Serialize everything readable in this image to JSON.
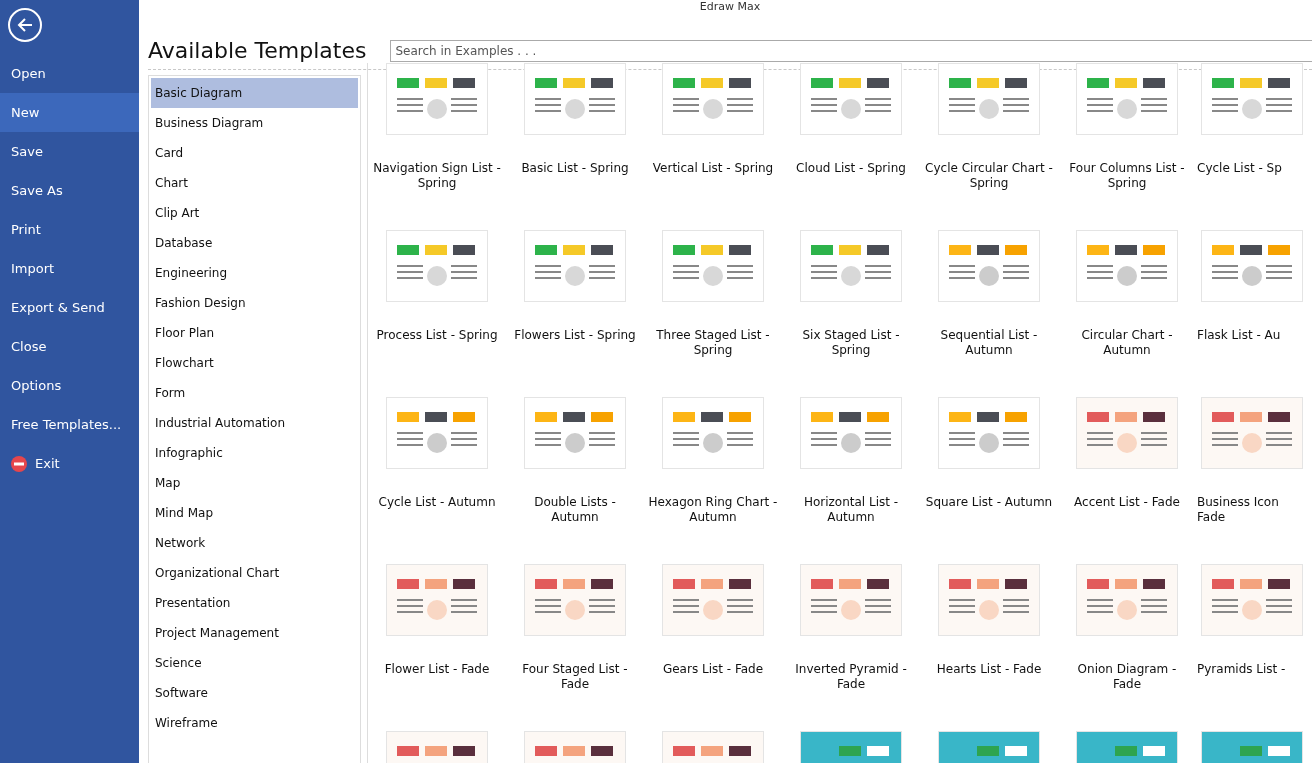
{
  "window": {
    "title": "Edraw Max"
  },
  "nav": [
    {
      "label": "Open",
      "selected": false
    },
    {
      "label": "New",
      "selected": true
    },
    {
      "label": "Save",
      "selected": false
    },
    {
      "label": "Save As",
      "selected": false
    },
    {
      "label": "Print",
      "selected": false
    },
    {
      "label": "Import",
      "selected": false
    },
    {
      "label": "Export & Send",
      "selected": false
    },
    {
      "label": "Close",
      "selected": false
    },
    {
      "label": "Options",
      "selected": false
    },
    {
      "label": "Free Templates...",
      "selected": false
    },
    {
      "label": "Exit",
      "selected": false,
      "kind": "exit"
    }
  ],
  "heading": "Available Templates",
  "search": {
    "placeholder": "Search in Examples . . ."
  },
  "categories": [
    {
      "label": "Basic Diagram",
      "selected": true
    },
    {
      "label": "Business Diagram",
      "selected": false
    },
    {
      "label": "Card",
      "selected": false
    },
    {
      "label": "Chart",
      "selected": false
    },
    {
      "label": "Clip Art",
      "selected": false
    },
    {
      "label": "Database",
      "selected": false
    },
    {
      "label": "Engineering",
      "selected": false
    },
    {
      "label": "Fashion Design",
      "selected": false
    },
    {
      "label": "Floor Plan",
      "selected": false
    },
    {
      "label": "Flowchart",
      "selected": false
    },
    {
      "label": "Form",
      "selected": false
    },
    {
      "label": "Industrial Automation",
      "selected": false
    },
    {
      "label": "Infographic",
      "selected": false
    },
    {
      "label": "Map",
      "selected": false
    },
    {
      "label": "Mind Map",
      "selected": false
    },
    {
      "label": "Network",
      "selected": false
    },
    {
      "label": "Organizational Chart",
      "selected": false
    },
    {
      "label": "Presentation",
      "selected": false
    },
    {
      "label": "Project Management",
      "selected": false
    },
    {
      "label": "Science",
      "selected": false
    },
    {
      "label": "Software",
      "selected": false
    },
    {
      "label": "Wireframe",
      "selected": false
    }
  ],
  "templates": [
    {
      "label": "Navigation Sign List - Spring",
      "kind": "spring"
    },
    {
      "label": "Basic List - Spring",
      "kind": "spring"
    },
    {
      "label": "Vertical List - Spring",
      "kind": "spring"
    },
    {
      "label": "Cloud List - Spring",
      "kind": "spring"
    },
    {
      "label": "Cycle Circular Chart - Spring",
      "kind": "spring"
    },
    {
      "label": "Four Columns List - Spring",
      "kind": "spring"
    },
    {
      "label": "Cycle List - Sp",
      "kind": "spring"
    },
    {
      "label": "Process List - Spring",
      "kind": "spring"
    },
    {
      "label": "Flowers List - Spring",
      "kind": "spring"
    },
    {
      "label": "Three Staged List - Spring",
      "kind": "spring"
    },
    {
      "label": "Six Staged List - Spring",
      "kind": "spring"
    },
    {
      "label": "Sequential List - Autumn",
      "kind": "autumn"
    },
    {
      "label": "Circular Chart - Autumn",
      "kind": "autumn"
    },
    {
      "label": "Flask List - Au",
      "kind": "autumn"
    },
    {
      "label": "Cycle List - Autumn",
      "kind": "autumn"
    },
    {
      "label": "Double Lists - Autumn",
      "kind": "autumn"
    },
    {
      "label": "Hexagon Ring Chart - Autumn",
      "kind": "autumn"
    },
    {
      "label": "Horizontal List - Autumn",
      "kind": "autumn"
    },
    {
      "label": "Square List - Autumn",
      "kind": "autumn"
    },
    {
      "label": "Accent List - Fade",
      "kind": "fade"
    },
    {
      "label": "Business Icon Fade",
      "kind": "fade"
    },
    {
      "label": "Flower List - Fade",
      "kind": "fade"
    },
    {
      "label": "Four Staged List - Fade",
      "kind": "fade"
    },
    {
      "label": "Gears List - Fade",
      "kind": "fade"
    },
    {
      "label": "Inverted Pyramid - Fade",
      "kind": "fade"
    },
    {
      "label": "Hearts List - Fade",
      "kind": "fade"
    },
    {
      "label": "Onion Diagram - Fade",
      "kind": "fade"
    },
    {
      "label": "Pyramids List -",
      "kind": "fade"
    },
    {
      "kind": "fade"
    },
    {
      "kind": "fade"
    },
    {
      "kind": "fade"
    },
    {
      "kind": "teal"
    },
    {
      "kind": "teal"
    },
    {
      "kind": "teal"
    },
    {
      "kind": "teal"
    }
  ]
}
